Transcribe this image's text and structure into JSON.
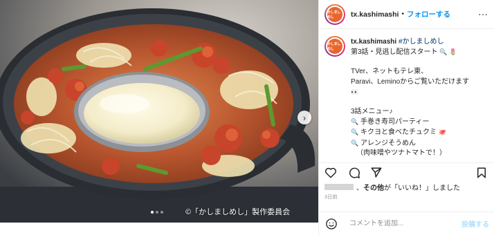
{
  "media": {
    "next_icon": "chevron-right-icon",
    "slide_index": 1,
    "slide_count": 3,
    "copyright": "©「かしましめし」製作委員会"
  },
  "header": {
    "avatar_text": "かしましめし",
    "username": "tx.kashimashi",
    "separator": "•",
    "follow_label": "フォローする",
    "more_icon": "more-horizontal-icon",
    "more_label": "···"
  },
  "caption": {
    "username": "tx.kashimashi",
    "hashtag": "#かしましめし",
    "line1": "第3話・見逃し配信スタート",
    "line1_icons": [
      "magnifier-emoji",
      "tulip-emoji"
    ],
    "line2": "TVer、ネットもテレ東、",
    "line3": "Paravi、Leminoからご覧いただけます",
    "line3_icon": "eyes-emoji",
    "menu_title": "3話メニュー♪",
    "menu": [
      "手巻き寿司パーティー",
      "キクヨと食べたチュクミ",
      "アレンジそうめん",
      "（肉味噌やツナトマトで！）"
    ],
    "menu_item_icon": "magnifier-emoji",
    "menu2_icon": "octopus-emoji"
  },
  "actions": {
    "like_icon": "heart-icon",
    "comment_icon": "comment-icon",
    "share_icon": "send-icon",
    "save_icon": "bookmark-icon"
  },
  "likes": {
    "text_bold": "その他",
    "text_rest": "が「いいね！」しました"
  },
  "date": "3日前",
  "comment": {
    "emoji_icon": "smiley-icon",
    "placeholder": "コメントを追加...",
    "post_label": "投稿する"
  },
  "colors": {
    "accent_blue": "#0095f6",
    "post_disabled": "#b2dffc",
    "text": "#262626",
    "muted": "#8e8e8e",
    "avatar_bg": "#e8662e"
  }
}
